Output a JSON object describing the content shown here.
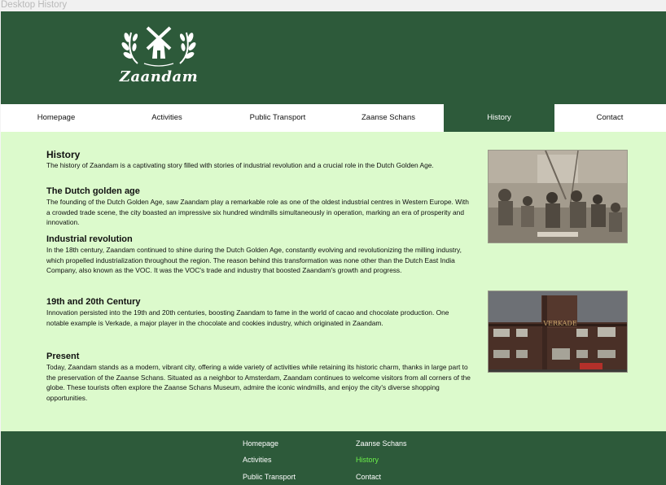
{
  "window": {
    "title": "Desktop History"
  },
  "brand": {
    "name": "Zaandam"
  },
  "nav": {
    "items": [
      {
        "label": "Homepage"
      },
      {
        "label": "Activities"
      },
      {
        "label": "Public Transport"
      },
      {
        "label": "Zaanse Schans"
      },
      {
        "label": "History",
        "active": true
      },
      {
        "label": "Contact"
      }
    ]
  },
  "main": {
    "history": {
      "title": "History",
      "text": "The history of Zaandam is a captivating story filled with stories of industrial revolution and a crucial role in the Dutch Golden Age."
    },
    "golden_age": {
      "title": "The Dutch golden age",
      "text": "The founding of the Dutch Golden Age, saw Zaandam play a remarkable role as one of the oldest industrial centres in Western Europe. With a crowded trade scene, the city boasted an impressive six hundred windmills simultaneously in operation, marking an era of prosperity and innovation."
    },
    "industrial": {
      "title": "Industrial revolution",
      "text": "In the 18th century, Zaandam continued to shine during the Dutch Golden Age, constantly evolving and revolutionizing the milling industry, which propelled industrialization throughout the region. The reason behind this transformation was none other than the Dutch East India Company, also known as the VOC. It was the VOC's trade and industry that boosted Zaandam's growth and progress."
    },
    "century": {
      "title": "19th and 20th Century",
      "text": "Innovation persisted into the 19th and 20th centuries, boosting Zaandam to fame in the world of cacao and chocolate production. One notable example is Verkade, a major player in the chocolate and cookies industry, which originated in Zaandam."
    },
    "present": {
      "title": "Present",
      "text": "Today, Zaandam stands as a modern, vibrant city, offering a wide variety of activities while retaining its historic charm, thanks in large part to the preservation of the Zaanse Schans. Situated as a neighbor to Amsterdam, Zaandam continues to welcome visitors from all corners of the globe. These tourists often explore the Zaanse Schans Museum, admire the iconic windmills, and enjoy the city's diverse shopping opportunities."
    },
    "factory_sign": "VERKADE"
  },
  "footer": {
    "links": [
      {
        "label": "Homepage"
      },
      {
        "label": "Activities"
      },
      {
        "label": "Public Transport"
      },
      {
        "label": "Zaanse Schans"
      },
      {
        "label": "History",
        "active": true
      },
      {
        "label": "Contact"
      }
    ]
  },
  "colors": {
    "brand_green": "#2d5a3a",
    "content_bg": "#dcfacc",
    "footer_active": "#6cf04a"
  }
}
